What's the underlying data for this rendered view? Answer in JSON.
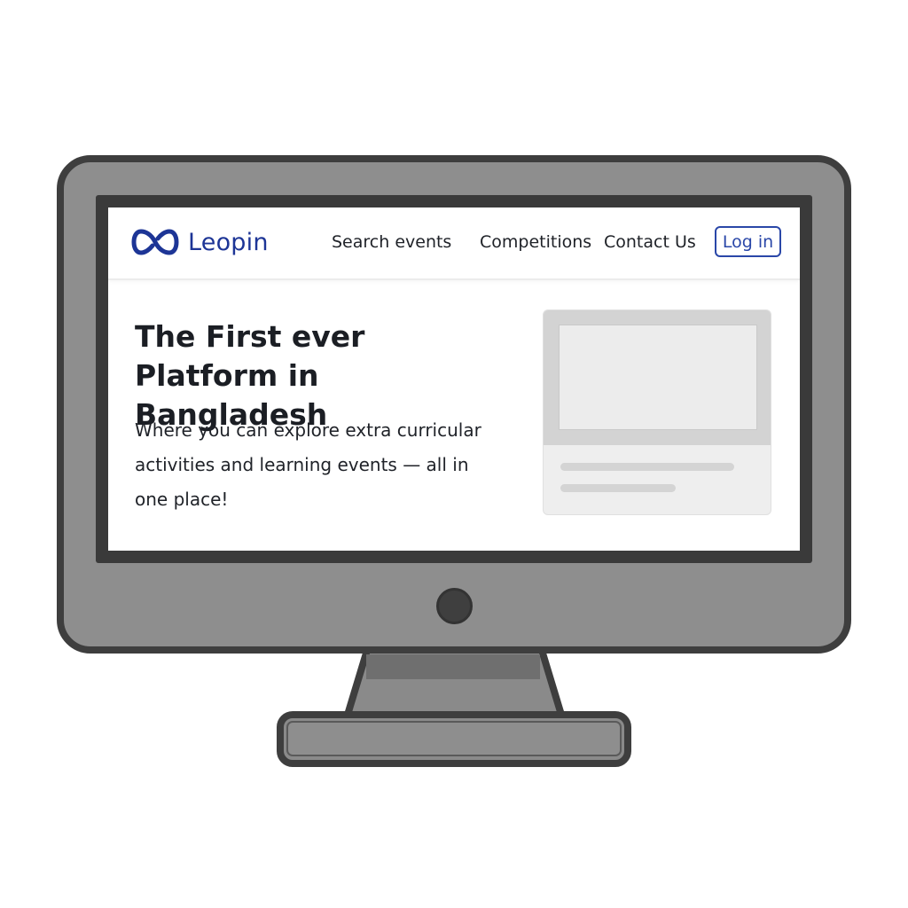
{
  "brand": {
    "name": "Leopin",
    "icon": "infinity-logo-icon",
    "color": "#1d3596"
  },
  "nav": {
    "items": [
      {
        "label": "Search events"
      },
      {
        "label": "Competitions"
      },
      {
        "label": "Contact Us"
      }
    ],
    "login_label": "Log in",
    "login_color": "#2a47a8"
  },
  "hero": {
    "title": "The First ever Platform in Bangladesh",
    "subtitle": "Where you can explore extra curricular activities and learning events — all in one place!"
  },
  "preview_card": {
    "icon": "image-placeholder-icon"
  },
  "device": {
    "type": "desktop-monitor",
    "bezel_color": "#8e8e8e",
    "outline_color": "#3e3e3e"
  }
}
